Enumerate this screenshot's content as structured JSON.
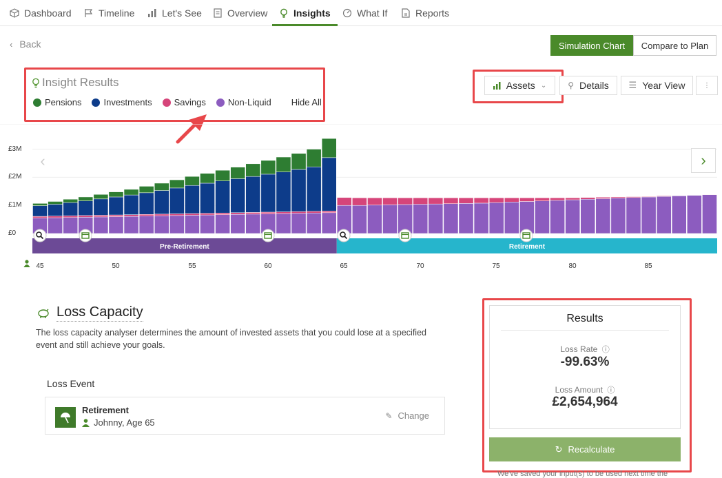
{
  "tabs": [
    {
      "label": "Dashboard",
      "icon": "box-icon"
    },
    {
      "label": "Timeline",
      "icon": "flag-icon"
    },
    {
      "label": "Let's See",
      "icon": "bar-chart-icon"
    },
    {
      "label": "Overview",
      "icon": "document-icon"
    },
    {
      "label": "Insights",
      "icon": "lightbulb-icon",
      "active": true
    },
    {
      "label": "What If",
      "icon": "gauge-icon"
    },
    {
      "label": "Reports",
      "icon": "report-icon"
    }
  ],
  "back_label": "Back",
  "header_buttons": {
    "simulation": "Simulation Chart",
    "compare": "Compare to Plan"
  },
  "insight": {
    "title": "Insight Results",
    "legend": [
      {
        "label": "Pensions",
        "color": "#2e7d32"
      },
      {
        "label": "Investments",
        "color": "#0d3c8a"
      },
      {
        "label": "Savings",
        "color": "#d6457a"
      },
      {
        "label": "Non-Liquid",
        "color": "#8c5cbf"
      }
    ],
    "hide_all": "Hide All"
  },
  "toolbar": {
    "assets": "Assets",
    "details": "Details",
    "year_view": "Year View"
  },
  "phases": {
    "pre": "Pre-Retirement",
    "post": "Retirement"
  },
  "chart_data": {
    "type": "bar",
    "stacked": true,
    "x": [
      45,
      46,
      47,
      48,
      49,
      50,
      51,
      52,
      53,
      54,
      55,
      56,
      57,
      58,
      59,
      60,
      61,
      62,
      63,
      64,
      65,
      66,
      67,
      68,
      69,
      70,
      71,
      72,
      73,
      74,
      75,
      76,
      77,
      78,
      79,
      80,
      81,
      82,
      83,
      84,
      85,
      86,
      87,
      88,
      89
    ],
    "x_ticks": [
      "45",
      "50",
      "55",
      "60",
      "65",
      "70",
      "75",
      "80",
      "85"
    ],
    "y_ticks": [
      "£0",
      "£1M",
      "£2M",
      "£3M"
    ],
    "ylim": [
      0,
      3500000
    ],
    "series": [
      {
        "name": "Non-Liquid",
        "color": "#8c5cbf",
        "values": [
          0.55,
          0.56,
          0.57,
          0.58,
          0.59,
          0.6,
          0.61,
          0.62,
          0.63,
          0.64,
          0.65,
          0.66,
          0.67,
          0.68,
          0.69,
          0.7,
          0.71,
          0.72,
          0.73,
          0.74,
          1.0,
          1.0,
          1.01,
          1.02,
          1.03,
          1.04,
          1.05,
          1.06,
          1.07,
          1.08,
          1.1,
          1.12,
          1.14,
          1.16,
          1.18,
          1.2,
          1.22,
          1.24,
          1.26,
          1.28,
          1.3,
          1.32,
          1.34,
          1.36,
          1.38
        ]
      },
      {
        "name": "Savings",
        "color": "#d6457a",
        "values": [
          0.06,
          0.06,
          0.06,
          0.06,
          0.06,
          0.06,
          0.06,
          0.06,
          0.06,
          0.06,
          0.06,
          0.06,
          0.06,
          0.06,
          0.06,
          0.06,
          0.06,
          0.06,
          0.06,
          0.06,
          0.28,
          0.27,
          0.26,
          0.25,
          0.24,
          0.23,
          0.22,
          0.21,
          0.2,
          0.19,
          0.17,
          0.15,
          0.13,
          0.11,
          0.09,
          0.07,
          0.06,
          0.05,
          0.04,
          0.03,
          0.02,
          0.02,
          0.01,
          0.01,
          0.01
        ]
      },
      {
        "name": "Investments",
        "color": "#0d3c8a",
        "values": [
          0.38,
          0.42,
          0.47,
          0.52,
          0.58,
          0.64,
          0.7,
          0.77,
          0.84,
          0.92,
          1.0,
          1.07,
          1.14,
          1.21,
          1.28,
          1.35,
          1.42,
          1.5,
          1.58,
          1.9,
          0,
          0,
          0,
          0,
          0,
          0,
          0,
          0,
          0,
          0,
          0,
          0,
          0,
          0,
          0,
          0,
          0,
          0,
          0,
          0,
          0,
          0,
          0,
          0,
          0
        ]
      },
      {
        "name": "Pensions",
        "color": "#2e7d32",
        "values": [
          0.08,
          0.1,
          0.12,
          0.14,
          0.16,
          0.18,
          0.2,
          0.23,
          0.26,
          0.29,
          0.32,
          0.35,
          0.38,
          0.41,
          0.45,
          0.49,
          0.53,
          0.57,
          0.63,
          0.68,
          0,
          0,
          0,
          0,
          0,
          0,
          0,
          0,
          0,
          0,
          0,
          0,
          0,
          0,
          0,
          0,
          0,
          0,
          0,
          0,
          0,
          0,
          0,
          0,
          0
        ]
      }
    ],
    "grid": true
  },
  "section": {
    "title": "Loss Capacity",
    "description": "The loss capacity analyser determines the amount of invested assets that you could lose at a specified event and still achieve your goals.",
    "loss_event_label": "Loss Event",
    "event_title": "Retirement",
    "event_person": "Johnny, Age 65",
    "change_label": "Change"
  },
  "results": {
    "title": "Results",
    "loss_rate_label": "Loss Rate",
    "loss_rate_value": "-99.63%",
    "loss_amount_label": "Loss Amount",
    "loss_amount_value": "£2,654,964",
    "recalculate": "Recalculate",
    "saved_note": "We've saved your input(s) to be used next time the"
  }
}
